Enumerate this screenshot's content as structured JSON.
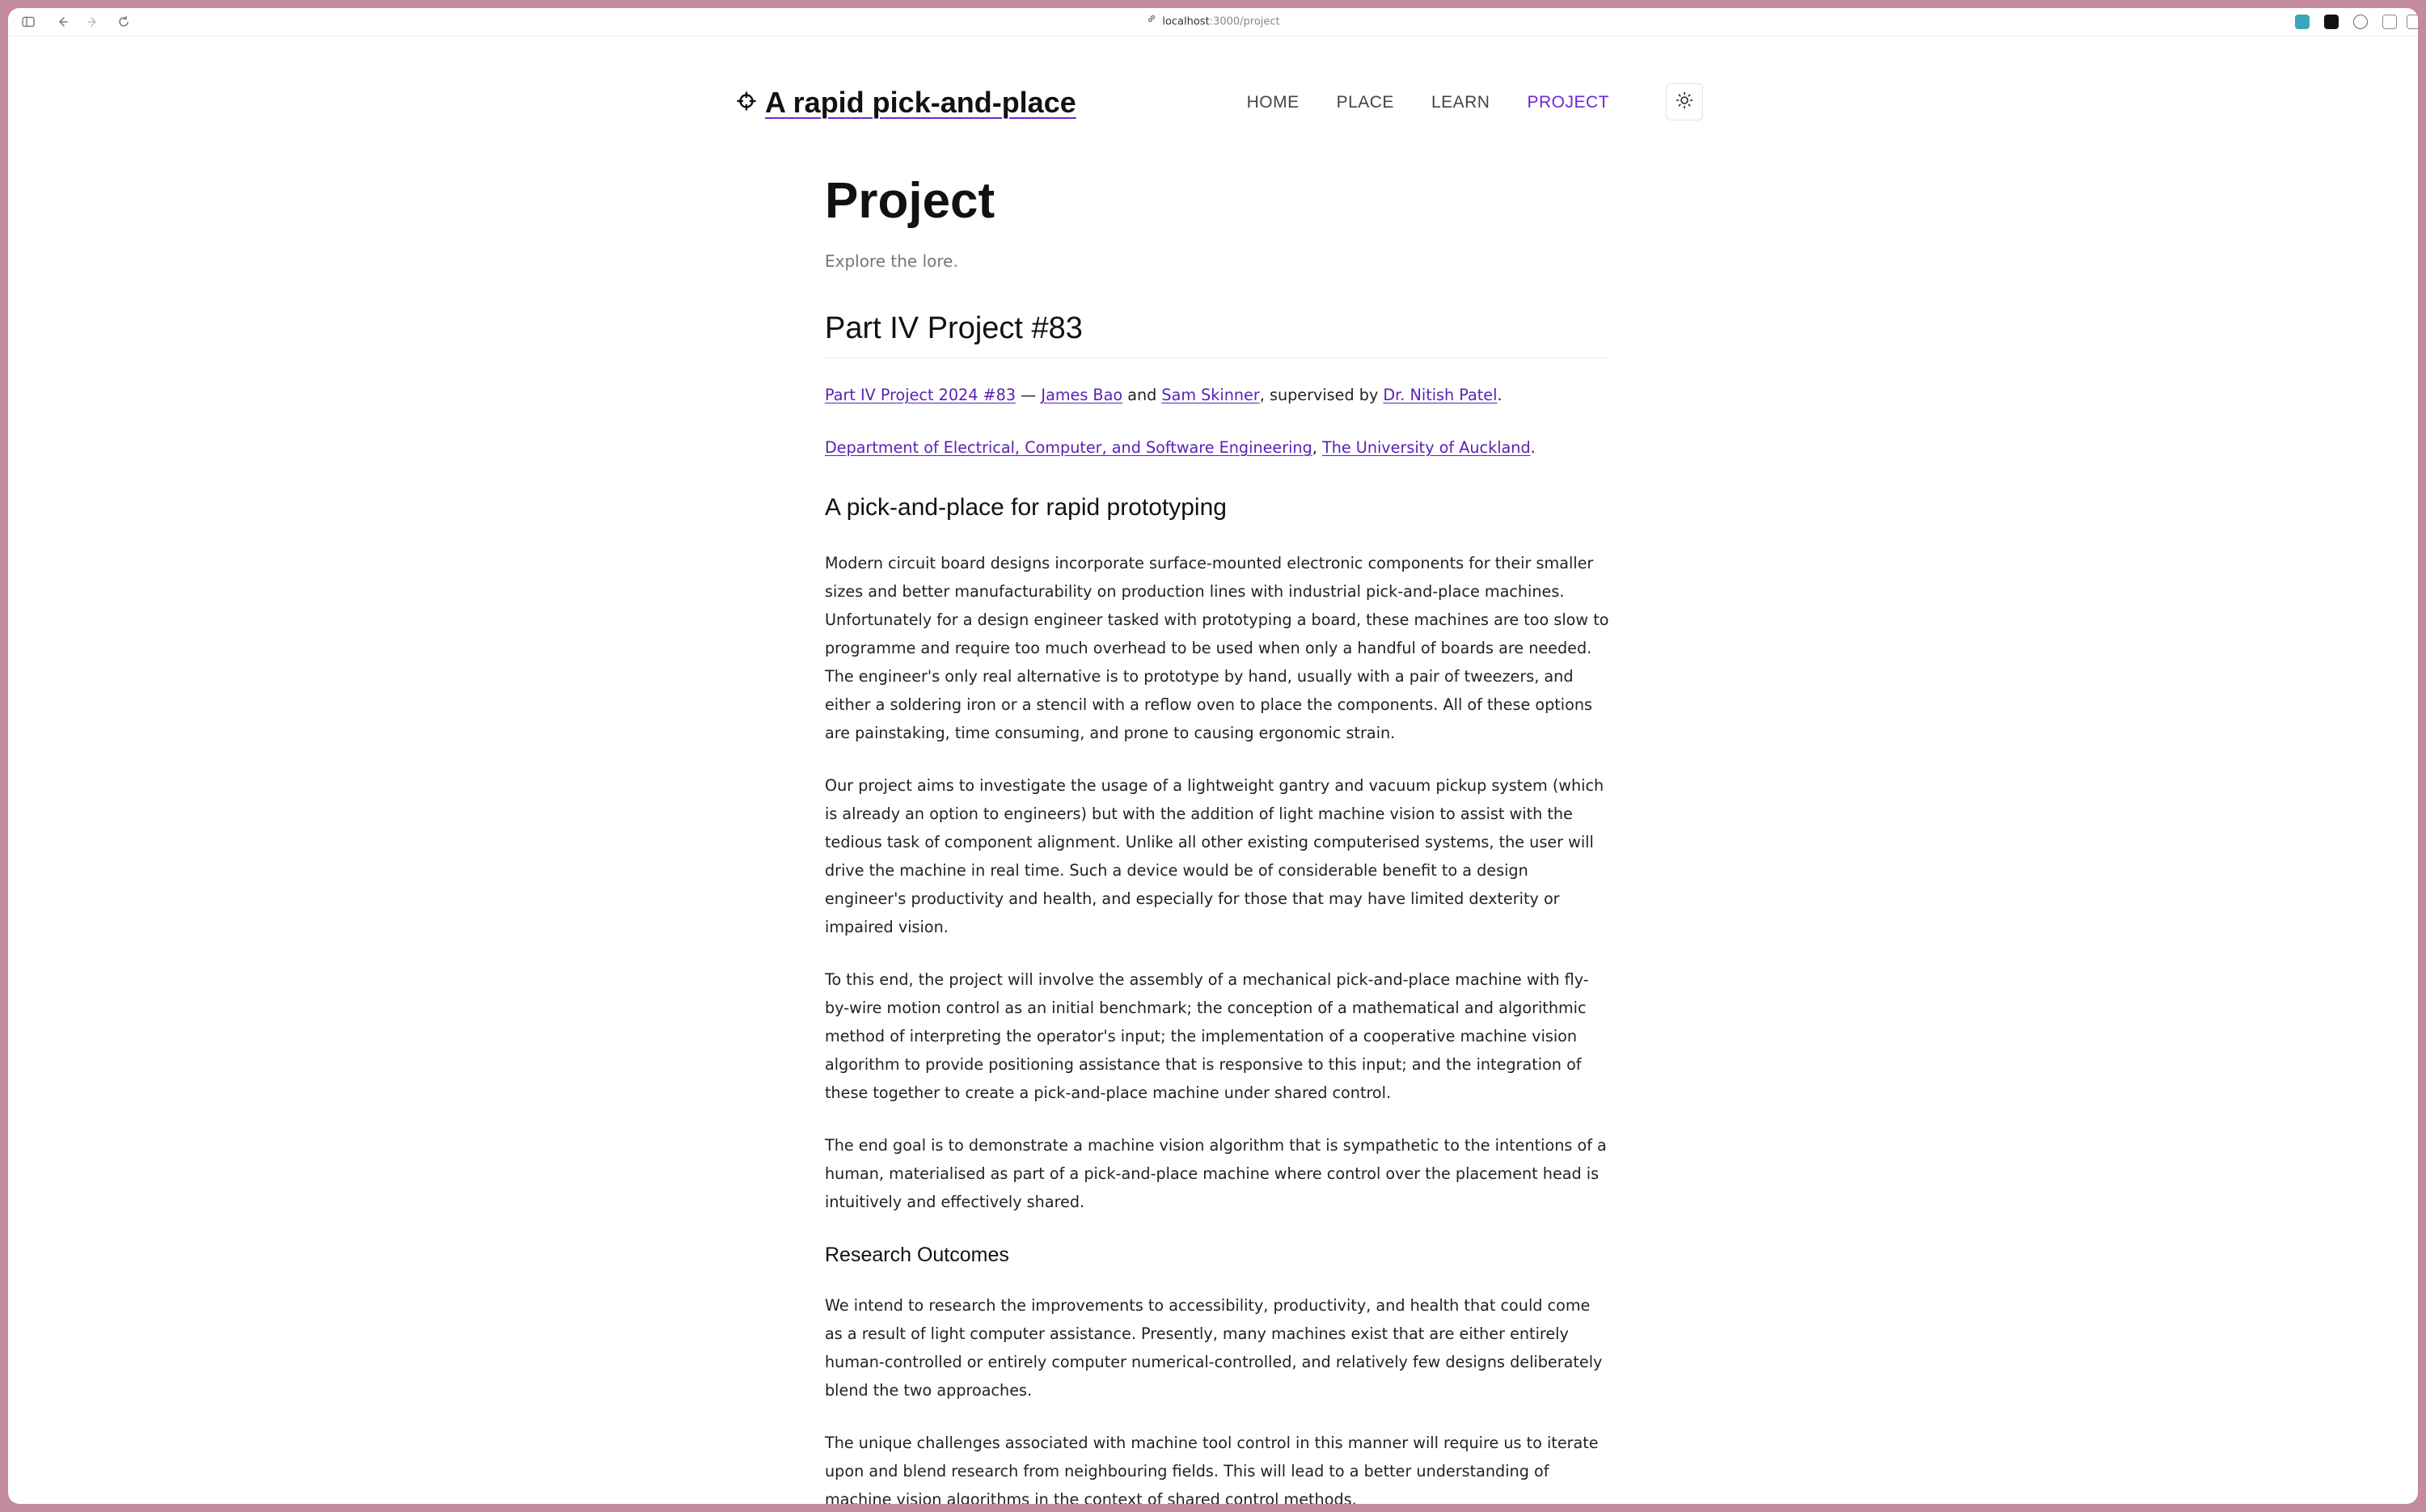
{
  "browser": {
    "url_host": "localhost",
    "url_path": ":3000/project"
  },
  "site": {
    "title": "A rapid pick-and-place",
    "nav": [
      "HOME",
      "PLACE",
      "LEARN",
      "PROJECT"
    ],
    "active_nav": "PROJECT"
  },
  "page": {
    "title": "Project",
    "subtitle": "Explore the lore.",
    "section_title": "Part IV Project #83",
    "meta": {
      "project_link": "Part IV Project 2024 #83",
      "dash": " — ",
      "author1": "James Bao",
      "and": " and ",
      "author2": "Sam Skinner",
      "supervised_by": ", supervised by ",
      "supervisor": "Dr. Nitish Patel",
      "period": ".",
      "department": "Department of Electrical, Computer, and Software Engineering",
      "comma": ", ",
      "university": "The University of Auckland",
      "period2": "."
    },
    "heading1": "A pick-and-place for rapid prototyping",
    "paragraphs1": [
      "Modern circuit board designs incorporate surface-mounted electronic components for their smaller sizes and better manufacturability on production lines with industrial pick-and-place machines. Unfortunately for a design engineer tasked with prototyping a board, these machines are too slow to programme and require too much overhead to be used when only a handful of boards are needed. The engineer's only real alternative is to prototype by hand, usually with a pair of tweezers, and either a soldering iron or a stencil with a reflow oven to place the components. All of these options are painstaking, time consuming, and prone to causing ergonomic strain.",
      "Our project aims to investigate the usage of a lightweight gantry and vacuum pickup system (which is already an option to engineers) but with the addition of light machine vision to assist with the tedious task of component alignment. Unlike all other existing computerised systems, the user will drive the machine in real time. Such a device would be of considerable benefit to a design engineer's productivity and health, and especially for those that may have limited dexterity or impaired vision.",
      "To this end, the project will involve the assembly of a mechanical pick-and-place machine with fly-by-wire motion control as an initial benchmark; the conception of a mathematical and algorithmic method of interpreting the operator's input; the implementation of a cooperative machine vision algorithm to provide positioning assistance that is responsive to this input; and the integration of these together to create a pick-and-place machine under shared control.",
      "The end goal is to demonstrate a machine vision algorithm that is sympathetic to the intentions of a human, materialised as part of a pick-and-place machine where control over the placement head is intuitively and effectively shared."
    ],
    "heading2": "Research Outcomes",
    "paragraphs2": [
      "We intend to research the improvements to accessibility, productivity, and health that could come as a result of light computer assistance. Presently, many machines exist that are either entirely human-controlled or entirely computer numerical-controlled, and relatively few designs deliberately blend the two approaches.",
      "The unique challenges associated with machine tool control in this manner will require us to iterate upon and blend research from neighbouring fields. This will lead to a better understanding of machine vision algorithms in the context of shared control methods."
    ]
  }
}
